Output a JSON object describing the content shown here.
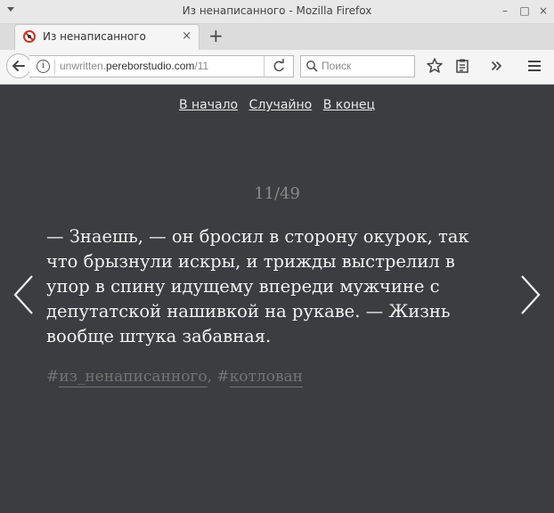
{
  "window": {
    "title": "Из ненаписанного - Mozilla Firefox",
    "minimize": "–",
    "maximize": "□",
    "close": "×"
  },
  "tab": {
    "title": "Из ненаписанного",
    "close": "×",
    "new_tab": "+"
  },
  "navbar": {
    "url_domain_prefix": "unwritten.",
    "url_domain_main": "pereborstudio.com",
    "url_path": "/11",
    "search_placeholder": "Поиск"
  },
  "page": {
    "nav_links": [
      "В начало",
      "Случайно",
      "В конец"
    ],
    "counter": "11/49",
    "story_text": "— Знаешь, — он бросил в сторону окурок, так что брызнули искры, и трижды выстрелил в упор в спину идущему впереди мужчине с депутатской нашивкой на рукаве. — Жизнь вообще штука забавная.",
    "tags": [
      "из_ненаписанного",
      "котлован"
    ],
    "tag_prefix": "#",
    "tag_separator": ", "
  },
  "colors": {
    "page_background": "#3c3d40",
    "story_text": "#f2f2f2",
    "muted_text": "#8a8a8a",
    "chrome_background": "#f5f5f5"
  },
  "icons": {
    "back": "arrow-left-icon",
    "info": "info-icon",
    "reload": "reload-icon",
    "search": "search-icon",
    "bookmark": "star-icon",
    "reading_list": "clipboard-icon",
    "overflow": "chevrons-right-icon",
    "menu": "hamburger-menu-icon",
    "prev": "chevron-left-icon",
    "next": "chevron-right-icon"
  }
}
